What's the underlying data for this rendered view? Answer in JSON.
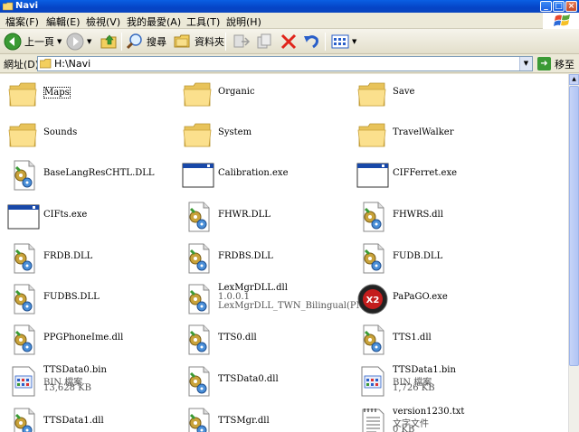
{
  "window": {
    "title": "Navi",
    "minimize": "_",
    "maximize": "□",
    "close": "×"
  },
  "menu": [
    "檔案(F)",
    "編輯(E)",
    "檢視(V)",
    "我的最愛(A)",
    "工具(T)",
    "說明(H)"
  ],
  "toolbar": {
    "back": "上一頁",
    "search": "搜尋",
    "folders": "資料夾"
  },
  "address": {
    "label": "網址(D)",
    "value": "H:\\Navi",
    "go": "移至"
  },
  "colors": {
    "titlebar": "#0a5fe3",
    "window_bg": "#ece9d8",
    "content_bg": "#ffffff"
  },
  "items": [
    {
      "name": "Maps",
      "icon": "folder"
    },
    {
      "name": "Organic",
      "icon": "folder"
    },
    {
      "name": "Save",
      "icon": "folder"
    },
    {
      "name": "Sounds",
      "icon": "folder"
    },
    {
      "name": "System",
      "icon": "folder"
    },
    {
      "name": "TravelWalker",
      "icon": "folder"
    },
    {
      "name": "BaseLangResCHTL.DLL",
      "icon": "dll"
    },
    {
      "name": "Calibration.exe",
      "icon": "exe-window"
    },
    {
      "name": "CIFFerret.exe",
      "icon": "exe-window"
    },
    {
      "name": "CIFts.exe",
      "icon": "exe-window"
    },
    {
      "name": "FHWR.DLL",
      "icon": "dll"
    },
    {
      "name": "FHWRS.dll",
      "icon": "dll"
    },
    {
      "name": "FRDB.DLL",
      "icon": "dll"
    },
    {
      "name": "FRDBS.DLL",
      "icon": "dll"
    },
    {
      "name": "FUDB.DLL",
      "icon": "dll"
    },
    {
      "name": "FUDBS.DLL",
      "icon": "dll"
    },
    {
      "name": "LexMgrDLL.dll",
      "line2": "1.0.0.1",
      "line3": "LexMgrDLL_TWN_Bilingual(PNA...",
      "icon": "dll"
    },
    {
      "name": "PaPaGO.exe",
      "icon": "papago-x2"
    },
    {
      "name": "PPGPhoneIme.dll",
      "icon": "dll"
    },
    {
      "name": "TTS0.dll",
      "icon": "dll"
    },
    {
      "name": "TTS1.dll",
      "icon": "dll"
    },
    {
      "name": "TTSData0.bin",
      "line2": "BIN 檔案",
      "line3": "13,628 KB",
      "icon": "bin-file"
    },
    {
      "name": "TTSData0.dll",
      "icon": "dll"
    },
    {
      "name": "TTSData1.bin",
      "line2": "BIN 檔案",
      "line3": "1,726 KB",
      "icon": "bin-file"
    },
    {
      "name": "TTSData1.dll",
      "icon": "dll"
    },
    {
      "name": "TTSMgr.dll",
      "icon": "dll"
    },
    {
      "name": "version1230.txt",
      "line2": "文字文件",
      "line3": "0 KB",
      "icon": "text-file"
    }
  ]
}
